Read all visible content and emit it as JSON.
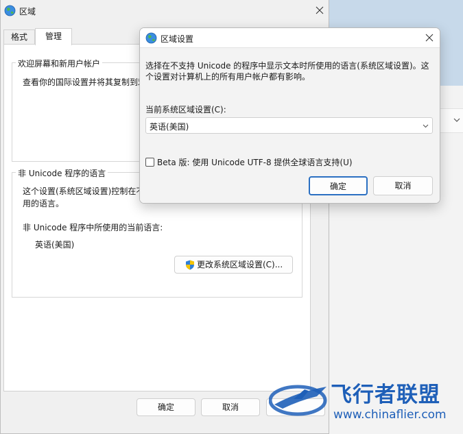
{
  "main_window": {
    "title": "区域",
    "tabs": [
      {
        "label": "格式"
      },
      {
        "label": "管理"
      }
    ],
    "welcome_group": {
      "legend": "欢迎屏幕和新用户帐户",
      "text": "查看你的国际设置并将其复制到欢"
    },
    "nonunicode_group": {
      "legend": "非 Unicode 程序的语言",
      "description_line1": "这个设置(系统区域设置)控制在不",
      "description_line2": "用的语言。",
      "current_label": "非 Unicode 程序中所使用的当前语言:",
      "current_value": "英语(美国)",
      "change_button": "更改系统区域设置(C)..."
    },
    "buttons": {
      "ok": "确定",
      "cancel": "取消"
    }
  },
  "dialog": {
    "title": "区域设置",
    "description": "选择在不支持 Unicode 的程序中显示文本时所使用的语言(系统区域设置)。这个设置对计算机上的所有用户帐户都有影响。",
    "locale_label": "当前系统区域设置(C):",
    "locale_value": "英语(美国)",
    "beta_checkbox_label": "Beta 版: 使用 Unicode UTF-8 提供全球语言支持(U)",
    "beta_checked": false,
    "ok": "确定",
    "cancel": "取消"
  },
  "watermark": {
    "brand_cn": "飞行者联盟",
    "url": "www.chinaflier.com",
    "brand_color": "#1e5fb8"
  },
  "colors": {
    "accent": "#2a6fc2",
    "window_bg": "#f0f0f0"
  }
}
